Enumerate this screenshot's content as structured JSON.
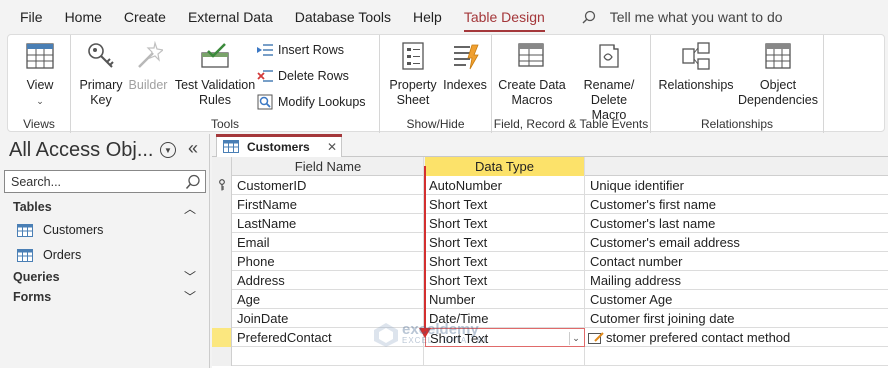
{
  "menu": {
    "items": [
      "File",
      "Home",
      "Create",
      "External Data",
      "Database Tools",
      "Help",
      "Table Design"
    ],
    "active": "Table Design",
    "tell_me": "Tell me what you want to do"
  },
  "ribbon": {
    "views": {
      "label": "Views",
      "view_button": "View"
    },
    "tools": {
      "label": "Tools",
      "primary_key": "Primary\nKey",
      "builder": "Builder",
      "test_validation": "Test Validation\nRules",
      "insert_rows": "Insert Rows",
      "delete_rows": "Delete Rows",
      "modify_lookups": "Modify Lookups"
    },
    "show_hide": {
      "label": "Show/Hide",
      "property_sheet": "Property\nSheet",
      "indexes": "Indexes"
    },
    "field_record": {
      "label": "Field, Record & Table Events",
      "create_data_macros": "Create Data\nMacros",
      "rename_delete_macro": "Rename/\nDelete Macro"
    },
    "relationships": {
      "label": "Relationships",
      "relationships": "Relationships",
      "object_dependencies": "Object\nDependencies"
    }
  },
  "nav": {
    "title": "All Access Obj...",
    "search_placeholder": "Search...",
    "sections": [
      {
        "label": "Tables",
        "expanded": true,
        "items": [
          "Customers",
          "Orders"
        ]
      },
      {
        "label": "Queries",
        "expanded": false,
        "items": []
      },
      {
        "label": "Forms",
        "expanded": false,
        "items": []
      }
    ]
  },
  "document": {
    "tab_label": "Customers",
    "columns": {
      "field_name": "Field Name",
      "data_type": "Data Type",
      "description": ""
    },
    "rows": [
      {
        "field": "CustomerID",
        "type": "AutoNumber",
        "desc": "Unique identifier",
        "primary_key": true
      },
      {
        "field": "FirstName",
        "type": "Short Text",
        "desc": "Customer's first name"
      },
      {
        "field": "LastName",
        "type": "Short Text",
        "desc": "Customer's last name"
      },
      {
        "field": "Email",
        "type": "Short Text",
        "desc": "Customer's email address"
      },
      {
        "field": "Phone",
        "type": "Short Text",
        "desc": "Contact number"
      },
      {
        "field": "Address",
        "type": "Short Text",
        "desc": "Mailing address"
      },
      {
        "field": "Age",
        "type": "Number",
        "desc": "Customer Age"
      },
      {
        "field": "JoinDate",
        "type": "Date/Time",
        "desc": "Cutomer first joining  date"
      },
      {
        "field": "PreferedContact",
        "type": "Short Text",
        "desc": "stomer prefered contact method",
        "current": true
      }
    ]
  },
  "watermark": {
    "main": "exceldemy",
    "sub": "EXCEL · DATA · BI"
  },
  "colors": {
    "accent": "#a4373a",
    "header_highlight": "#fce26a",
    "arrow": "#d32f2f"
  }
}
